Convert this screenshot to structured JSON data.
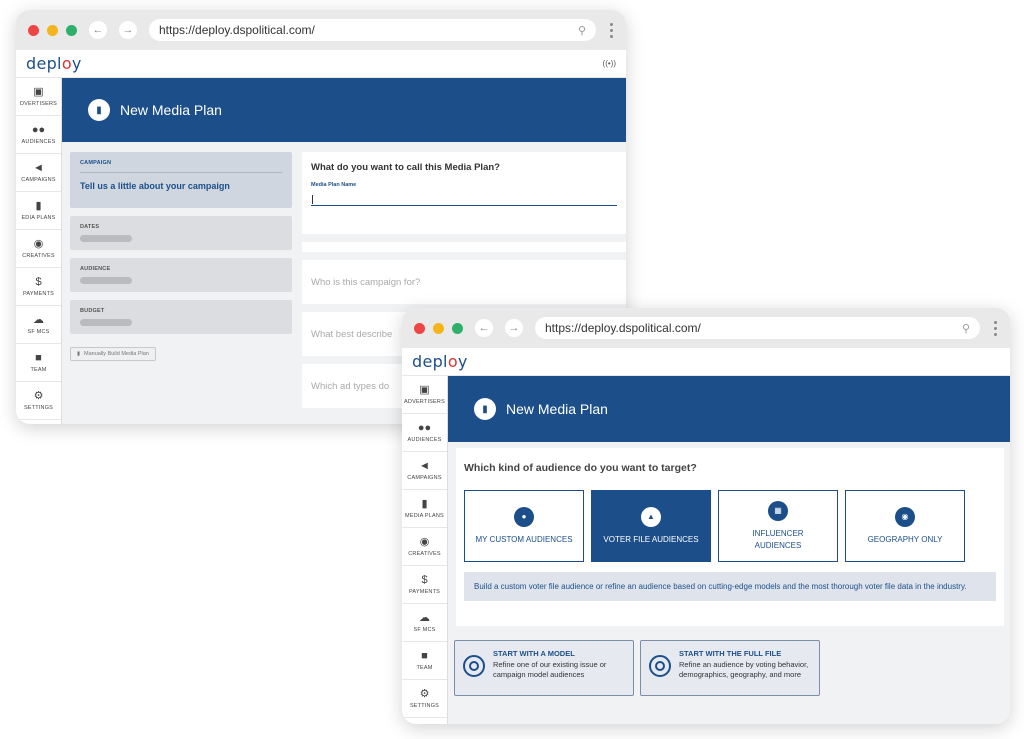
{
  "browser": {
    "url": "https://deploy.dspolitical.com/"
  },
  "app": {
    "logo": "deploy",
    "page_title": "New Media Plan"
  },
  "sidebar": {
    "items": [
      {
        "label": "ADVERTISERS",
        "icon": "store-icon"
      },
      {
        "label": "AUDIENCES",
        "icon": "people-icon"
      },
      {
        "label": "CAMPAIGNS",
        "icon": "megaphone-icon"
      },
      {
        "label": "MEDIA PLANS",
        "icon": "document-icon"
      },
      {
        "label": "CREATIVES",
        "icon": "palette-icon"
      },
      {
        "label": "PAYMENTS",
        "icon": "dollar-icon"
      },
      {
        "label": "SF MCS",
        "icon": "cloud-icon"
      },
      {
        "label": "TEAM",
        "icon": "id-card-icon"
      },
      {
        "label": "SETTINGS",
        "icon": "gear-icon"
      }
    ],
    "items_short": [
      "DVERTISERS",
      "AUDIENCES",
      "CAMPAIGNS",
      "EDIA PLANS",
      "CREATIVES",
      "PAYMENTS",
      "SF MCS",
      "TEAM",
      "SETTINGS"
    ]
  },
  "window1": {
    "steps": [
      {
        "key": "CAMPAIGN",
        "text": "Tell us a little about your campaign"
      },
      {
        "key": "DATES"
      },
      {
        "key": "AUDIENCE"
      },
      {
        "key": "BUDGET"
      }
    ],
    "manual_button": "Manually Build Media Plan",
    "question_main": "What do you want to call this Media Plan?",
    "field_label": "Media Plan Name",
    "questions": [
      "Who is this campaign for?",
      "What best describe",
      "Which ad types do"
    ]
  },
  "window2": {
    "question": "Which kind of audience do you want to target?",
    "options": [
      {
        "label": "MY CUSTOM AUDIENCES",
        "icon": "people-icon",
        "selected": false
      },
      {
        "label": "VOTER FILE AUDIENCES",
        "icon": "ballot-icon",
        "selected": true
      },
      {
        "label": "INFLUENCER AUDIENCES",
        "icon": "building-icon",
        "selected": false
      },
      {
        "label": "GEOGRAPHY ONLY",
        "icon": "map-pin-icon",
        "selected": false
      }
    ],
    "description": "Build a custom voter file audience or refine an audience based on cutting-edge models and the most thorough voter file data in the industry.",
    "start_cards": [
      {
        "title": "START WITH A MODEL",
        "text": "Refine one of our existing issue or campaign model audiences"
      },
      {
        "title": "START WITH THE FULL FILE",
        "text": "Refine an audience by voting behavior, demographics, geography, and more"
      }
    ]
  },
  "colors": {
    "brand_blue": "#1c4f8a",
    "logo_accent": "#dd3333"
  }
}
